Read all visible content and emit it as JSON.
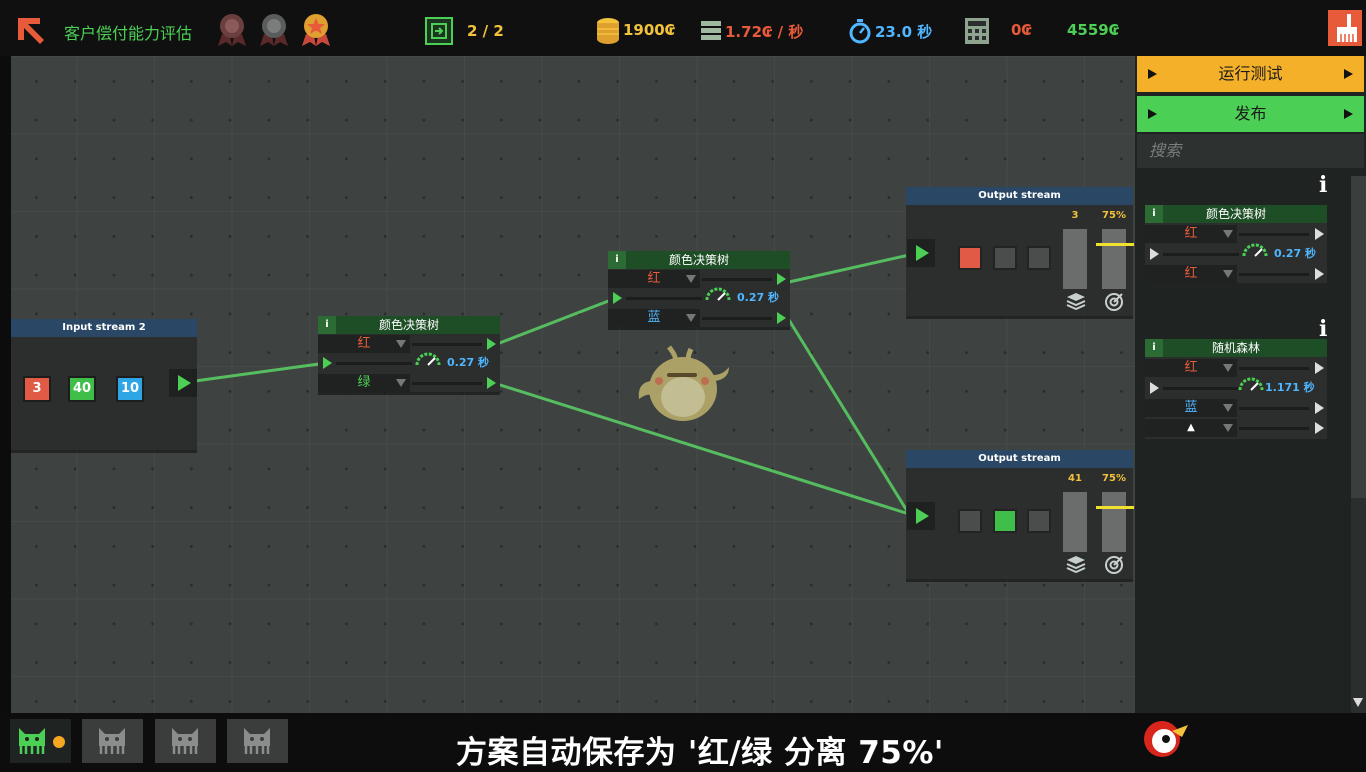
{
  "topbar": {
    "title": "客户偿付能力评估",
    "levels": "2 / 2",
    "coins": "1900₢",
    "cost_rate": "1.72₢ / 秒",
    "time": "23.0 秒",
    "calc_value": "0₢",
    "total": "4559₢",
    "colors": {
      "accent": "#e75a3a",
      "gold": "#f2c23b",
      "green": "#4ccf55"
    }
  },
  "input_stream": {
    "title": "Input stream 2",
    "values": [
      "3",
      "40",
      "10"
    ]
  },
  "tree_a": {
    "info": "i",
    "title": "颜色决策树",
    "opt1": "红",
    "opt2": "绿",
    "speed": "0.27 秒"
  },
  "tree_b": {
    "info": "i",
    "title": "颜色决策树",
    "opt1": "红",
    "opt2": "蓝",
    "speed": "0.27 秒"
  },
  "output_1": {
    "title": "Output stream",
    "count": "3",
    "percent": "75%",
    "meter_fill": 0.75
  },
  "output_2": {
    "title": "Output stream",
    "count": "41",
    "percent": "75%",
    "meter_fill": 0.75
  },
  "sidebar": {
    "run_test": "运行测试",
    "publish": "发布",
    "search_placeholder": "搜索",
    "card1": {
      "info": "i",
      "title": "颜色决策树",
      "opt1": "红",
      "opt2": "红",
      "speed": "0.27 秒"
    },
    "card2": {
      "info": "i",
      "title": "随机森林",
      "opt1": "红",
      "opt2": "蓝",
      "opt3": "▲",
      "speed": "1.171 秒"
    }
  },
  "bottombar": {
    "caption": "方案自动保存为 '红/绿 分离 75%'"
  }
}
